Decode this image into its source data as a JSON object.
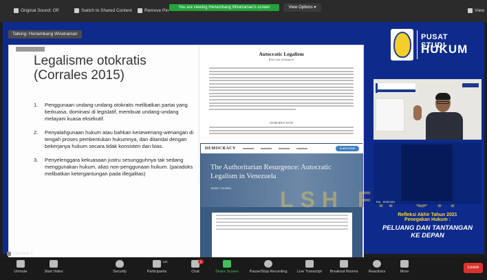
{
  "topbar": {
    "original_sound": "Original Sound: Off",
    "switch_shared": "Switch to Shared Content",
    "remove_pin": "Remove Pin",
    "viewing_banner": "You are viewing Herlambang Wiratraman's screen",
    "view_options": "View Options ▾",
    "view": "View"
  },
  "talking": "Talking: Herlambang Wiratraman",
  "slide": {
    "title_line1": "Legalisme otokratis",
    "title_line2": "(Corrales 2015)",
    "bullets": [
      {
        "num": "1.",
        "text": "Penggunaan undang-undang otokratis melibatkan partai yang berkuasa, dominasi di legislatif, membuat undang-undang melayani kuasa eksekutif."
      },
      {
        "num": "2.",
        "text": "Penyalahgunaan hukum atau bahkan kesewenang-wenangan di tengah proses pembentukan hukumnya, dan ditandai dengan bekerjanya hukum secara tidak konsisten dan bias."
      },
      {
        "num": "3.",
        "text": "Penyelenggara kekuasaan justru sesungguhnya tak sedang menggunakan hukum, alias non-penggunaan hukum. (paradoks melibatkan ketergantungan pada illegalitas)"
      }
    ],
    "doc_title": "Autocratic Legalism",
    "doc_author": "Kim Lane Scheppele",
    "doc_section": "INTRODUCTION",
    "journal_logo": "DEMOCRACY",
    "journal_button": "SUBSCRIBE",
    "journal_title": "The Authoritarian Resurgence: Autocratic Legalism in Venezuela",
    "journal_author": "Javier Corrales"
  },
  "watermark": "LSH FH UII",
  "logo": {
    "line1": "PUSAT STUDI",
    "line2": "HUKUM"
  },
  "participant_name": "Mu...Rahman",
  "promo": {
    "line1": "Refleksi Akhir Tahun 2021",
    "line2": "Penegakan Hukum :",
    "line3": "PELUANG DAN TANTANGAN",
    "line4": "KE DEPAN"
  },
  "operator": "Operator 1",
  "toolbar": {
    "unmute": "Unmute",
    "start_video": "Start Video",
    "security": "Security",
    "participants": "Participants",
    "participants_count": "141",
    "chat": "Chat",
    "chat_badge": "1",
    "share_screen": "Share Screen",
    "pause_recording": "Pause/Stop Recording",
    "live_transcript": "Live Transcript",
    "breakout": "Breakout Rooms",
    "reactions": "Reactions",
    "more": "More",
    "leave": "Leave"
  },
  "colors": {
    "stage": "#0e2b8c",
    "accent_green": "#23a33a",
    "leave_red": "#d8342c",
    "promo_yellow": "#ffd533"
  }
}
